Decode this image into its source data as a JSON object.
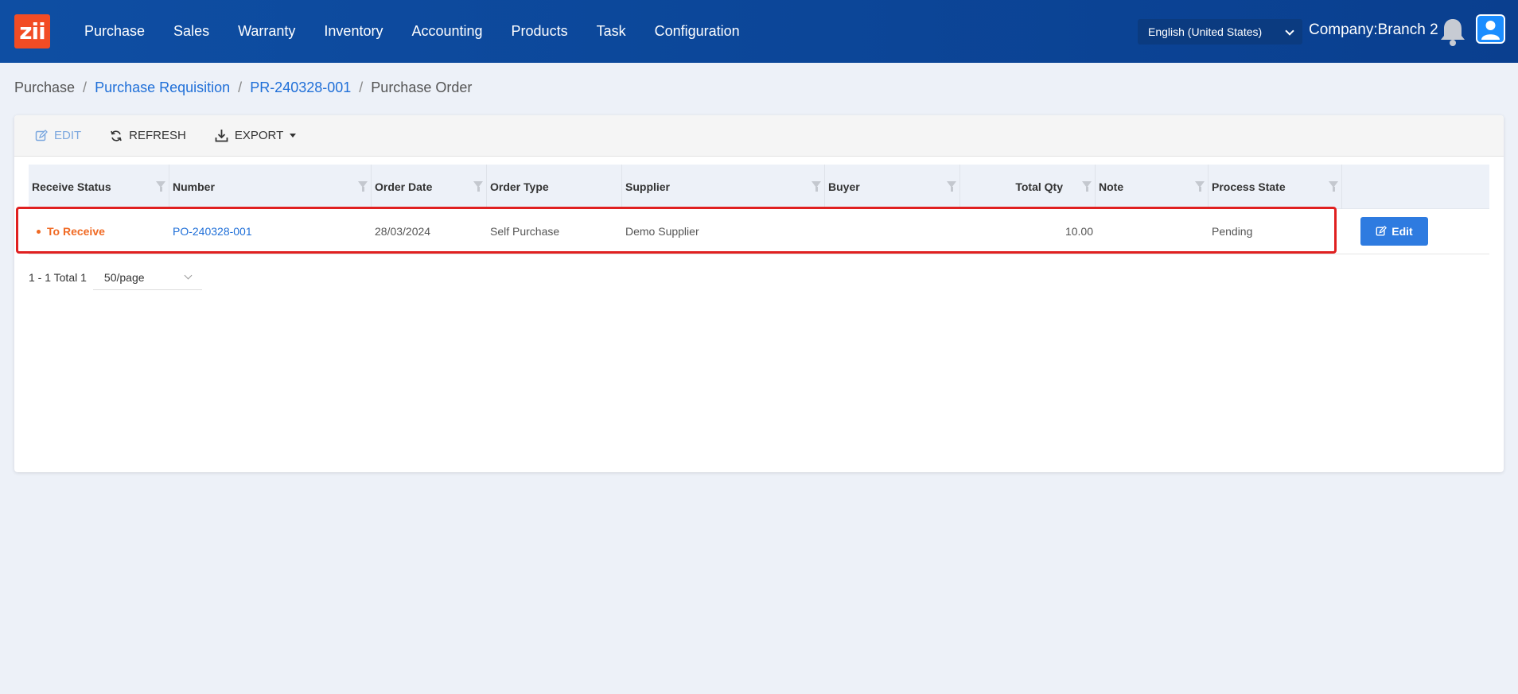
{
  "app": {
    "logo_text": "zii",
    "nav": [
      "Purchase",
      "Sales",
      "Warranty",
      "Inventory",
      "Accounting",
      "Products",
      "Task",
      "Configuration"
    ],
    "language": "English (United States)",
    "company": "Company:Branch 2"
  },
  "breadcrumb": {
    "items": [
      "Purchase",
      "Purchase Requisition",
      "PR-240328-001",
      "Purchase Order"
    ],
    "separator": "/"
  },
  "toolbar": {
    "edit_label": "EDIT",
    "refresh_label": "REFRESH",
    "export_label": "EXPORT"
  },
  "table": {
    "columns": [
      "Receive Status",
      "Number",
      "Order Date",
      "Order Type",
      "Supplier",
      "Buyer",
      "Total Qty",
      "Note",
      "Process State"
    ],
    "rows": [
      {
        "receive_status": "To Receive",
        "number": "PO-240328-001",
        "order_date": "28/03/2024",
        "order_type": "Self Purchase",
        "supplier": "Demo Supplier",
        "buyer": "",
        "total_qty": "10.00",
        "note": "",
        "process_state": "Pending",
        "action_label": "Edit"
      }
    ]
  },
  "pager": {
    "summary": "1 - 1 Total 1",
    "page_size": "50/page"
  },
  "colors": {
    "topbar": "#0e4ea3",
    "accent": "#2e7be0",
    "status_orange": "#f06a24",
    "highlight_red": "#e02020"
  }
}
